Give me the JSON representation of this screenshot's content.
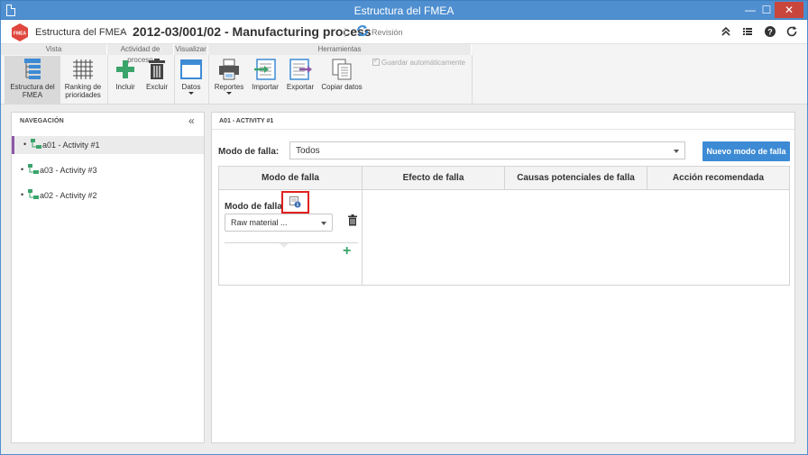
{
  "window": {
    "title": "Estructura del FMEA",
    "min_glyph": "—",
    "max_glyph": "☐",
    "close_glyph": "✕"
  },
  "header": {
    "breadcrumb_parent": "Estructura del FMEA",
    "breadcrumb_separator": "›",
    "record_title": "2012-03/001/02 - Manufacturing process",
    "revision_label": "Revisión",
    "logo_text": "FMEA"
  },
  "ribbon": {
    "groups": {
      "vista": "Vista",
      "actividad": "Actividad de proceso",
      "visualizar": "Visualizar",
      "herramientas": "Herramientas"
    },
    "buttons": {
      "estructura_line1": "Estructura del",
      "estructura_line2": "FMEA",
      "ranking_line1": "Ranking de",
      "ranking_line2": "prioridades",
      "incluir": "Incluir",
      "excluir": "Excluir",
      "datos": "Datos",
      "reportes": "Reportes",
      "importar": "Importar",
      "exportar": "Exportar",
      "copiar": "Copiar datos"
    },
    "autosave_label": "Guardar automáticamente"
  },
  "navigation": {
    "title": "NAVEGACIÓN",
    "collapse_glyph": "«",
    "items": [
      {
        "label": "a01 - Activity #1",
        "selected": true
      },
      {
        "label": "a03 - Activity #3",
        "selected": false
      },
      {
        "label": "a02 - Activity #2",
        "selected": false
      }
    ]
  },
  "main": {
    "breadcrumb": "A01 - ACTIVITY #1",
    "filter_label": "Modo de falla:",
    "filter_value": "Todos",
    "new_button": "Nuevo modo de falla",
    "table": {
      "headers": [
        "Modo de falla",
        "Efecto de falla",
        "Causas potenciales de falla",
        "Acción recomendada"
      ],
      "failure_mode_label": "Modo de falla",
      "failure_mode_value": "Raw material ...",
      "add_glyph": "+"
    }
  },
  "colors": {
    "titlebar": "#4f8fd0",
    "accent_button": "#3d8bd4",
    "selected_marker": "#8e58a8",
    "highlight_box": "#e02020",
    "add_green": "#3aa46a",
    "logo_red": "#e0463d"
  }
}
